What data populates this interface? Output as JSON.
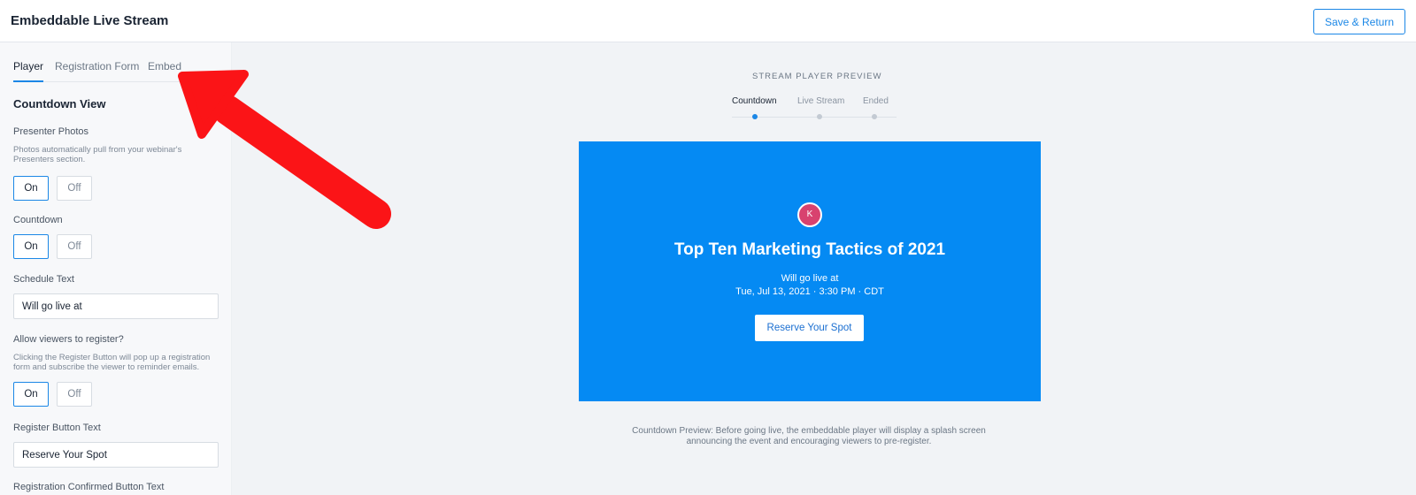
{
  "header": {
    "title": "Embeddable Live Stream",
    "save_label": "Save & Return"
  },
  "sidebar": {
    "tabs": [
      {
        "label": "Player",
        "active": true
      },
      {
        "label": "Registration Form",
        "active": false
      },
      {
        "label": "Embed",
        "active": false
      }
    ],
    "section_title": "Countdown View",
    "presenter_photos": {
      "label": "Presenter Photos",
      "help": "Photos automatically pull from your webinar's Presenters section.",
      "selected": "On"
    },
    "countdown": {
      "label": "Countdown",
      "selected": "On"
    },
    "schedule_text": {
      "label": "Schedule Text",
      "value": "Will go live at"
    },
    "allow_register": {
      "label": "Allow viewers to register?",
      "help": "Clicking the Register Button will pop up a registration form and subscribe the viewer to reminder emails.",
      "selected": "On"
    },
    "register_button_text": {
      "label": "Register Button Text",
      "value": "Reserve Your Spot"
    },
    "cut_off_label": "Registration Confirmed Button Text",
    "toggle_on": "On",
    "toggle_off": "Off"
  },
  "preview": {
    "heading": "STREAM PLAYER PREVIEW",
    "steps": [
      {
        "label": "Countdown",
        "active": true
      },
      {
        "label": "Live Stream",
        "active": false
      },
      {
        "label": "Ended",
        "active": false
      }
    ],
    "player": {
      "background": "#058af3",
      "avatar_initial": "K",
      "avatar_color": "#d8426f",
      "title": "Top Ten Marketing Tactics of 2021",
      "live_at": "Will go live at",
      "date": "Tue, Jul 13, 2021 · 3:30 PM · CDT",
      "button_label": "Reserve Your Spot"
    },
    "caption": "Countdown Preview: Before going live, the embeddable player will display a splash screen announcing the event and encouraging viewers to pre-register."
  },
  "annotation": {
    "icon": "red-arrow-icon",
    "color": "#fb1417"
  },
  "colors": {
    "accent": "#1b87e6"
  }
}
